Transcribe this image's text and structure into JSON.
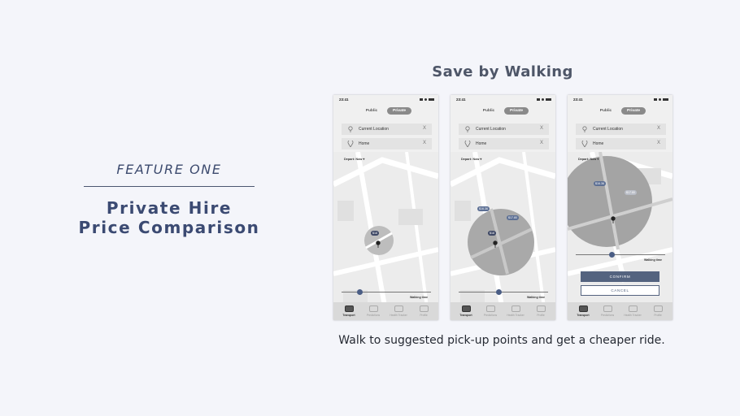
{
  "feature": {
    "label": "FEATURE  ONE",
    "title_line1": "Private Hire",
    "title_line2": "Price Comparison"
  },
  "section_title": "Save by Walking",
  "caption": "Walk to suggested pick-up points and get a cheaper ride.",
  "colors": {
    "accent": "#54637f",
    "title": "#3b4a72",
    "background": "#f4f5fa"
  },
  "screens": [
    {
      "status_time": "23:41",
      "segment": {
        "public": "Public",
        "private": "Private",
        "selected": "Private"
      },
      "from": {
        "value": "Current Location",
        "clear": "X"
      },
      "to": {
        "value": "Home",
        "clear": "X"
      },
      "depart": "Depart: Now ▾",
      "prices": [
        "$18"
      ],
      "walking_label": "Walking time",
      "walking_level": 0.2,
      "tabs": [
        "Transport",
        "Predictions",
        "Health Tracker",
        "Profile"
      ]
    },
    {
      "status_time": "23:41",
      "segment": {
        "public": "Public",
        "private": "Private",
        "selected": "Private"
      },
      "from": {
        "value": "Current Location",
        "clear": "X"
      },
      "to": {
        "value": "Home",
        "clear": "X"
      },
      "depart": "Depart: Now ▾",
      "prices": [
        "$18",
        "$16.36",
        "$17.80"
      ],
      "walking_label": "Walking time",
      "walking_level": 0.45,
      "tabs": [
        "Transport",
        "Predictions",
        "Health Tracker",
        "Profile"
      ]
    },
    {
      "status_time": "23:41",
      "segment": {
        "public": "Public",
        "private": "Private",
        "selected": "Private"
      },
      "from": {
        "value": "Current Location",
        "clear": "X"
      },
      "to": {
        "value": "Home",
        "clear": "X"
      },
      "depart": "Depart: Now ▾",
      "prices": [
        "$16.36",
        "$17.80"
      ],
      "walking_label": "Walking time",
      "walking_level": 0.4,
      "confirm_label": "CONFIRM",
      "cancel_label": "CANCEL",
      "tabs": [
        "Transport",
        "Predictions",
        "Health Tracker",
        "Profile"
      ]
    }
  ]
}
